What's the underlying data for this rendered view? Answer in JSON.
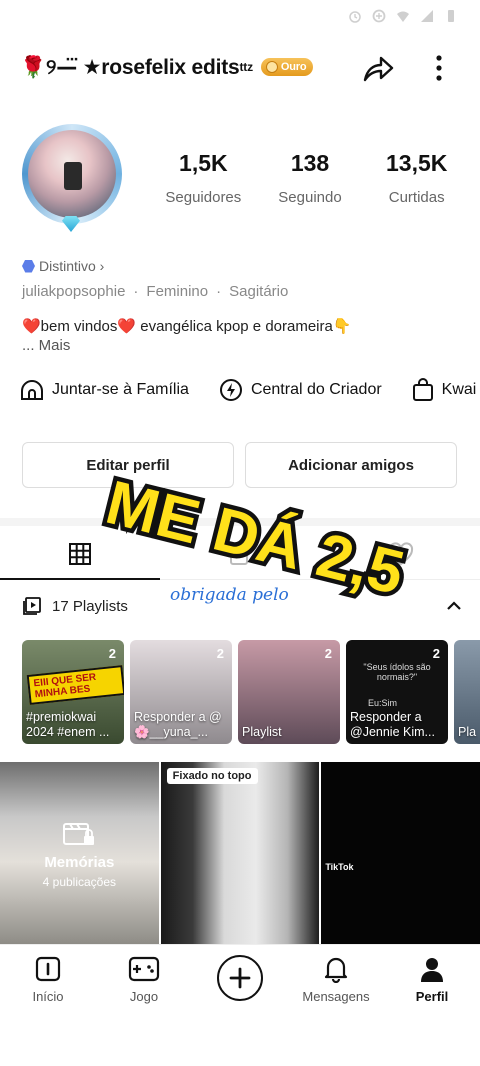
{
  "status_bar": {
    "icons": [
      "alarm-icon",
      "data-saver-icon",
      "wifi-icon",
      "signal-icon",
      "battery-icon"
    ]
  },
  "header": {
    "username": "🌹୨—⃛ ★rosefelix edits",
    "username_sup": "ttz",
    "badge": "Ouro",
    "share_icon": "share-icon",
    "menu_icon": "more-vertical-icon"
  },
  "stats": [
    {
      "value": "1,5K",
      "label": "Seguidores"
    },
    {
      "value": "138",
      "label": "Seguindo"
    },
    {
      "value": "13,5K",
      "label": "Curtidas"
    }
  ],
  "profile": {
    "distintivo": "Distintivo ›",
    "handle": "juliakpopsophie",
    "gender": "Feminino",
    "sign": "Sagitário",
    "bio": "❤️bem vindos❤️ evangélica kpop e dorameira👇",
    "more": "...  Mais"
  },
  "shortcuts": [
    {
      "label": "Juntar-se à Família",
      "icon": "family-icon"
    },
    {
      "label": "Central do Criador",
      "icon": "lightning-icon"
    },
    {
      "label": "Kwai Shop",
      "icon": "shopping-bag-icon"
    }
  ],
  "buttons": {
    "edit_profile": "Editar perfil",
    "add_friends": "Adicionar amigos"
  },
  "tabs": [
    "grid-icon",
    "lock-icon",
    "heart-icon"
  ],
  "playlists": {
    "header": "17 Playlists",
    "items": [
      {
        "count": "2",
        "caption": "#premiokwai 2024 #enem ...",
        "sticker": "EIII QUE SER MINHA BES",
        "bg": "#4a5a3a"
      },
      {
        "count": "2",
        "caption": "Responder a @ 🌸__yuna_...",
        "bg": "#c7c0c4"
      },
      {
        "count": "2",
        "caption": "Playlist",
        "bg": "#8a6a7a"
      },
      {
        "count": "2",
        "caption": "Responder a @Jennie Kim...",
        "quote": "\"Seus ídolos são normais?\"",
        "reply": "Eu:Sim",
        "bg": "#111111"
      },
      {
        "count": "",
        "caption": "Pla",
        "bg": "#6a7a8a"
      }
    ]
  },
  "grid": {
    "memorias_title": "Memórias",
    "memorias_sub": "4 publicações",
    "pinned": "Fixado no topo",
    "tiktok": "TikTok"
  },
  "overlay": {
    "big_text": "ME DÁ 2,5",
    "script_text": "obrigada pelo"
  },
  "bottom_nav": [
    {
      "label": "Início",
      "icon": "home-icon"
    },
    {
      "label": "Jogo",
      "icon": "gamepad-icon"
    },
    {
      "label": "",
      "icon": "plus-icon"
    },
    {
      "label": "Mensagens",
      "icon": "bell-icon"
    },
    {
      "label": "Perfil",
      "icon": "person-icon"
    }
  ],
  "colors": {
    "accent_gold": "#f0a62a",
    "brand_blue": "#5b7de8",
    "overlay_yellow": "#ffe11a"
  }
}
